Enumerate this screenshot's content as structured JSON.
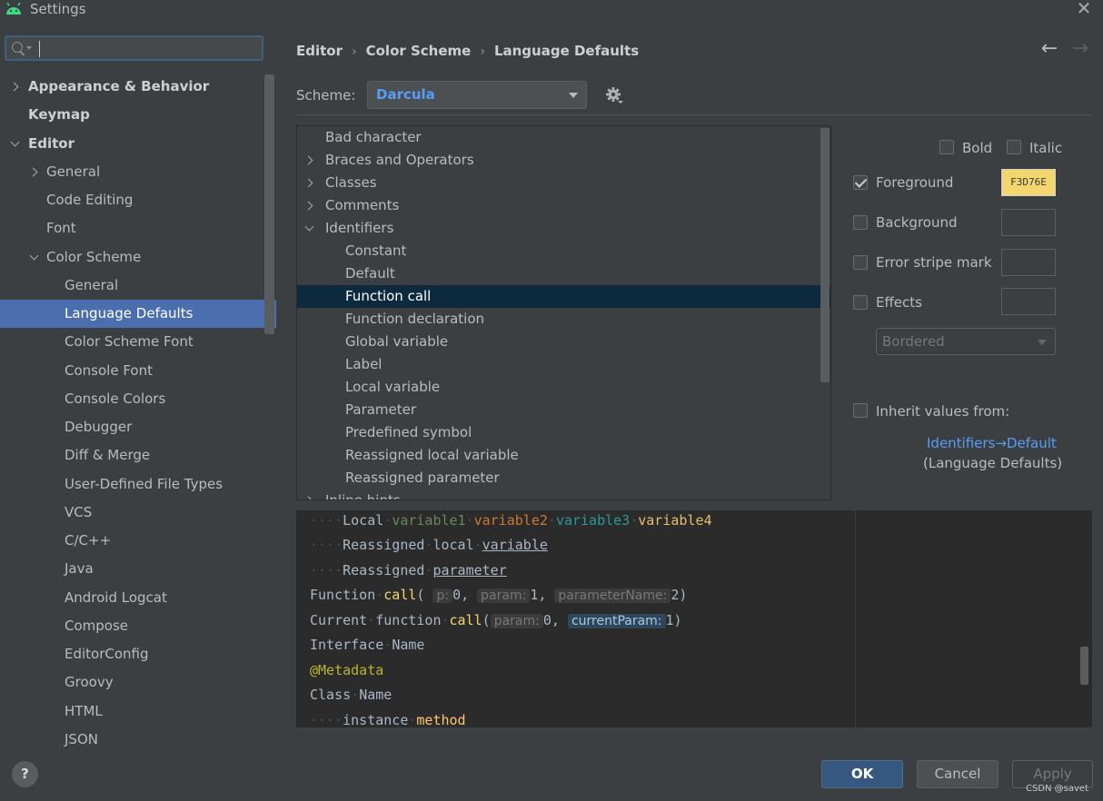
{
  "window": {
    "title": "Settings",
    "close": "✕"
  },
  "search": {
    "value": "",
    "placeholder": ""
  },
  "sidebar": {
    "items": [
      {
        "label": "Appearance & Behavior"
      },
      {
        "label": "Keymap"
      },
      {
        "label": "Editor"
      },
      {
        "label": "General"
      },
      {
        "label": "Code Editing"
      },
      {
        "label": "Font"
      },
      {
        "label": "Color Scheme"
      },
      {
        "label": "General"
      },
      {
        "label": "Language Defaults"
      },
      {
        "label": "Color Scheme Font"
      },
      {
        "label": "Console Font"
      },
      {
        "label": "Console Colors"
      },
      {
        "label": "Debugger"
      },
      {
        "label": "Diff & Merge"
      },
      {
        "label": "User-Defined File Types"
      },
      {
        "label": "VCS"
      },
      {
        "label": "C/C++"
      },
      {
        "label": "Java"
      },
      {
        "label": "Android Logcat"
      },
      {
        "label": "Compose"
      },
      {
        "label": "EditorConfig"
      },
      {
        "label": "Groovy"
      },
      {
        "label": "HTML"
      },
      {
        "label": "JSON"
      }
    ],
    "selected": "Language Defaults"
  },
  "breadcrumb": [
    "Editor",
    "Color Scheme",
    "Language Defaults"
  ],
  "nav": {
    "back": "←",
    "forward": "→"
  },
  "scheme": {
    "label": "Scheme:",
    "value": "Darcula"
  },
  "attributes": {
    "items": [
      "Bad character",
      "Braces and Operators",
      "Classes",
      "Comments",
      "Identifiers",
      "Constant",
      "Default",
      "Function call",
      "Function declaration",
      "Global variable",
      "Label",
      "Local variable",
      "Parameter",
      "Predefined symbol",
      "Reassigned local variable",
      "Reassigned parameter",
      "Inline hints"
    ],
    "selected": "Function call"
  },
  "options": {
    "bold": "Bold",
    "italic": "Italic",
    "foreground": "Foreground",
    "foreground_color": "F3D76E",
    "foreground_checked": true,
    "background": "Background",
    "error_stripe": "Error stripe mark",
    "effects": "Effects",
    "effects_type": "Bordered",
    "inherit": "Inherit values from:",
    "inherit_link": "Identifiers→Default",
    "inherit_note": "(Language Defaults)"
  },
  "preview": {
    "l1": {
      "a": "Local",
      "v1": "variable1",
      "v2": "variable2",
      "v3": "variable3",
      "v4": "variable4"
    },
    "l2": {
      "a": "Reassigned",
      "b": "local",
      "c": "variable"
    },
    "l3": {
      "a": "Reassigned",
      "b": "parameter"
    },
    "l4": {
      "a": "Function",
      "fn": "call",
      "h1": "p:",
      "n1": "0,",
      "h2": "param:",
      "n2": "1,",
      "h3": "parameterName:",
      "n3": "2)"
    },
    "l5": {
      "a": "Current",
      "b": "function",
      "fn": "call",
      "h1": "param:",
      "n1": "0,",
      "h2": "currentParam:",
      "n2": "1)"
    },
    "l6": {
      "a": "Interface",
      "b": "Name"
    },
    "l7": {
      "a": "@Metadata"
    },
    "l8": {
      "a": "Class",
      "b": "Name"
    },
    "l9": {
      "a": "instance",
      "b": "method"
    }
  },
  "buttons": {
    "help": "?",
    "ok": "OK",
    "cancel": "Cancel",
    "apply": "Apply"
  },
  "watermark": "CSDN @savet",
  "colors": {
    "accent": "#4b6eaf",
    "link": "#589df6",
    "foreground_swatch": "#f3d76e",
    "selection": "#0d293e"
  }
}
